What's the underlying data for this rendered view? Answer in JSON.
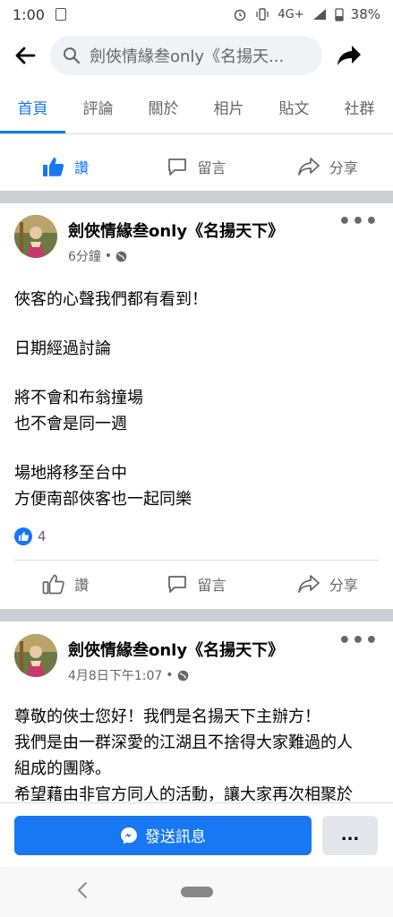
{
  "status": {
    "time": "1:00",
    "network": "4G+",
    "battery": "38%"
  },
  "search": {
    "query": "劍俠情緣叁only《名揚天..."
  },
  "tabs": [
    "首頁",
    "評論",
    "關於",
    "相片",
    "貼文",
    "社群"
  ],
  "actions": {
    "like": "讚",
    "comment": "留言",
    "share": "分享"
  },
  "posts": [
    {
      "page_name": "劍俠情緣叁only《名揚天下》",
      "time": "6分鐘",
      "paragraphs": [
        [
          "俠客的心聲我們都有看到！"
        ],
        [
          "日期經過討論"
        ],
        [
          "將不會和布翁撞場",
          "也不會是同一週"
        ],
        [
          "場地將移至台中",
          "方便南部俠客也一起同樂"
        ]
      ],
      "reaction_count": "4"
    },
    {
      "page_name": "劍俠情緣叁only《名揚天下》",
      "time": "4月8日下午1:07",
      "lines": [
        "尊敬的俠士您好！我們是名揚天下主辦方！",
        "我們是由一群深愛的江湖且不捨得大家難過的人",
        "組成的團隊。",
        "希望藉由非官方同人的活動，讓大家再次相聚於"
      ]
    }
  ],
  "bottom": {
    "message_button": "發送訊息",
    "more_button": "..."
  },
  "colors": {
    "accent": "#1877f2",
    "divider": "#ccd0d5"
  }
}
